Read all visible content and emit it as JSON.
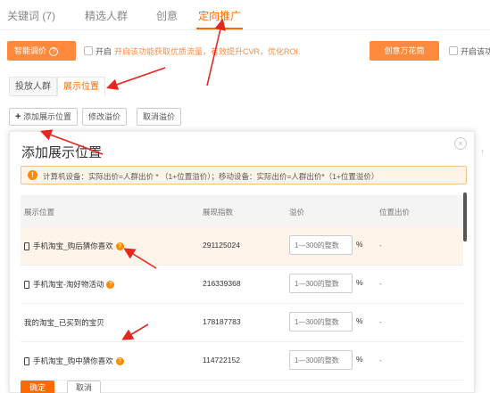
{
  "top_tabs": [
    {
      "label": "关键词 (7)"
    },
    {
      "label": "精选人群"
    },
    {
      "label": "创意"
    },
    {
      "label": "定向推广",
      "active": true
    }
  ],
  "smart_bid": {
    "label": "智能调价",
    "help_icon": "?",
    "toggle_label": "开启",
    "description": "开启该功能获取优质流量，有效提升CVR，优化ROI."
  },
  "brand_bid": {
    "label": "创意万花筒",
    "toggle_label": "开启该功"
  },
  "sub_tabs": [
    {
      "label": "投放人群"
    },
    {
      "label": "展示位置",
      "active": true
    }
  ],
  "toolbar": {
    "add_label": "添加展示位置",
    "edit_label": "修改溢价",
    "cancel_label": "取消溢价"
  },
  "dialog": {
    "title": "添加展示位置",
    "close_icon": "×",
    "notice_icon": "!",
    "notice": "计算机设备：实际出价=人群出价 * （1+位置溢价）；移动设备：实际出价=人群出价*（1+位置溢价）",
    "columns": [
      "展示位置",
      "展现指数",
      "溢价",
      "位置出价"
    ],
    "rows": [
      {
        "name": "手机淘宝_购后猜你喜欢",
        "index": "291125024",
        "placeholder": "1—300的整数",
        "unit": "%",
        "price": "-",
        "mobile": true,
        "help": true
      },
      {
        "name": "手机淘宝-淘好物活动",
        "index": "216339368",
        "placeholder": "1—300的整数",
        "unit": "%",
        "price": "-",
        "mobile": true,
        "help": true
      },
      {
        "name": "我的淘宝_已买到的宝贝",
        "index": "178187783",
        "placeholder": "1—300的整数",
        "unit": "%",
        "price": "-",
        "mobile": false,
        "help": false
      },
      {
        "name": "手机淘宝_购中猜你喜欢",
        "index": "114722152",
        "placeholder": "1—300的整数",
        "unit": "%",
        "price": "-",
        "mobile": true,
        "help": true
      }
    ],
    "confirm_label": "确定",
    "cancel_label": "取消"
  },
  "colors": {
    "accent": "#ff6a00",
    "badge": "#ff8a3d",
    "annotation": "#e8251e"
  }
}
